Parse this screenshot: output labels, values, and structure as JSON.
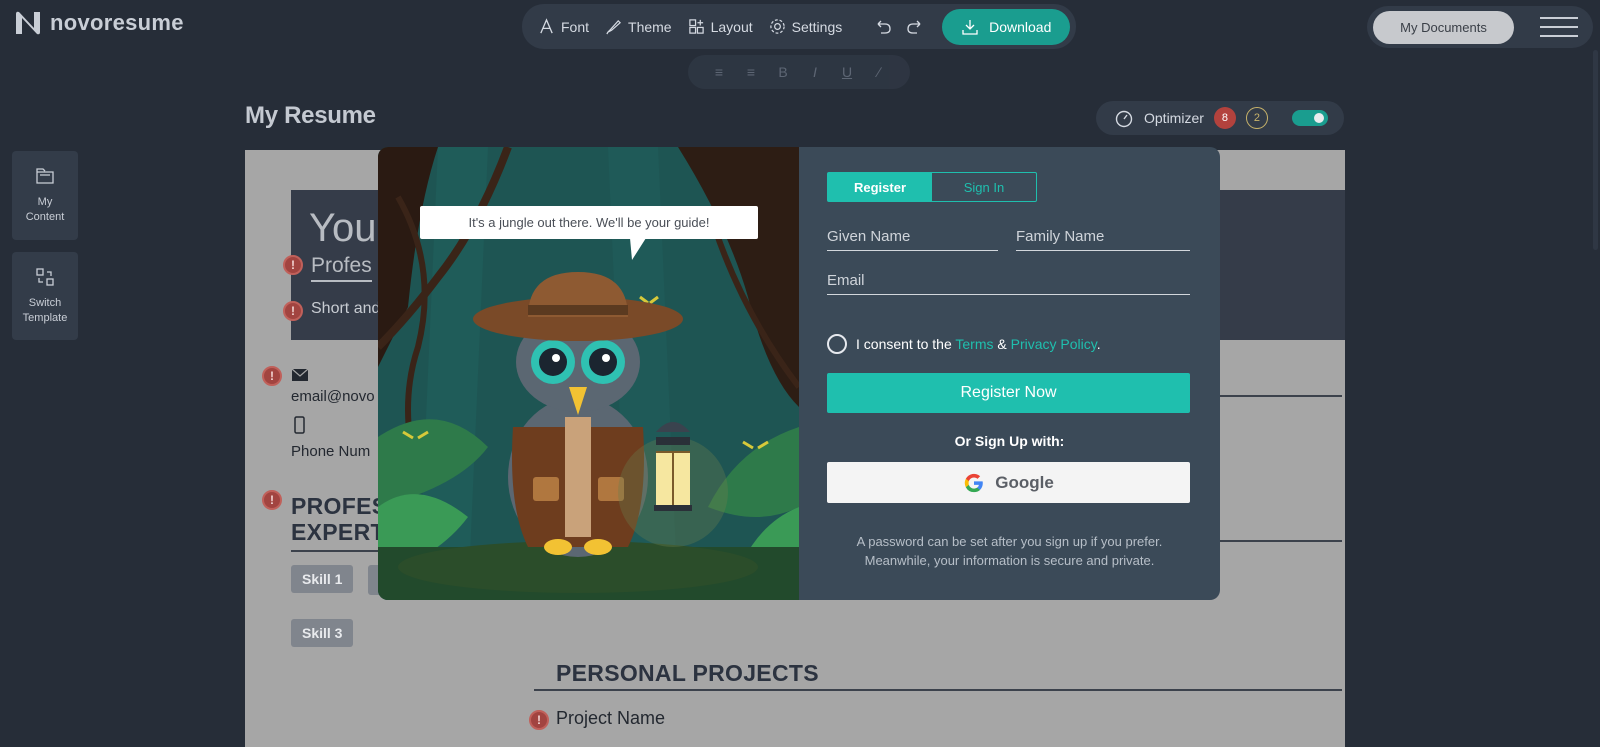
{
  "brand": {
    "name": "novoresume"
  },
  "toolbar": {
    "font_label": "Font",
    "theme_label": "Theme",
    "layout_label": "Layout",
    "settings_label": "Settings",
    "download_label": "Download"
  },
  "format_bar": {
    "bold": "B",
    "italic": "I",
    "underline": "U"
  },
  "header_right": {
    "my_documents_label": "My Documents"
  },
  "page": {
    "title": "My Resume"
  },
  "optimizer": {
    "label": "Optimizer",
    "errors_count": "8",
    "warnings_count": "2",
    "enabled": true
  },
  "sidebar": {
    "items": [
      {
        "label": "My Content",
        "icon": "folder-icon"
      },
      {
        "label": "Switch Template",
        "icon": "switch-template-icon"
      }
    ]
  },
  "resume": {
    "name_partial": "You",
    "profession_partial": "Profes",
    "summary_partial": "Short and",
    "email_partial": "email@novo",
    "phone_partial": "Phone Num",
    "section_skills_line1": "PROFES",
    "section_skills_line2": "EXPERT",
    "skills": [
      "Skill 1",
      "Skill 3"
    ],
    "section_projects": "PERSONAL PROJECTS",
    "project_name": "Project Name"
  },
  "modal": {
    "speech_bubble": "It's a jungle out there. We'll be your guide!",
    "tabs": [
      {
        "label": "Register",
        "active": true
      },
      {
        "label": "Sign In",
        "active": false
      }
    ],
    "fields": {
      "given_name_placeholder": "Given Name",
      "family_name_placeholder": "Family Name",
      "email_placeholder": "Email"
    },
    "consent": {
      "prefix": "I consent to the",
      "terms_link": "Terms",
      "amp": "&",
      "privacy_link": "Privacy Policy",
      "suffix": "."
    },
    "register_button": "Register Now",
    "or_text": "Or Sign Up with:",
    "google_button": "Google",
    "note_line1": "A password can be set after you sign up if you prefer.",
    "note_line2": "Meanwhile, your information is secure and private."
  },
  "colors": {
    "background": "#262d38",
    "accent": "#1fbfae",
    "download": "#1a9d8f",
    "modal_panel": "#3b4a58",
    "error_badge": "#b3423d"
  }
}
